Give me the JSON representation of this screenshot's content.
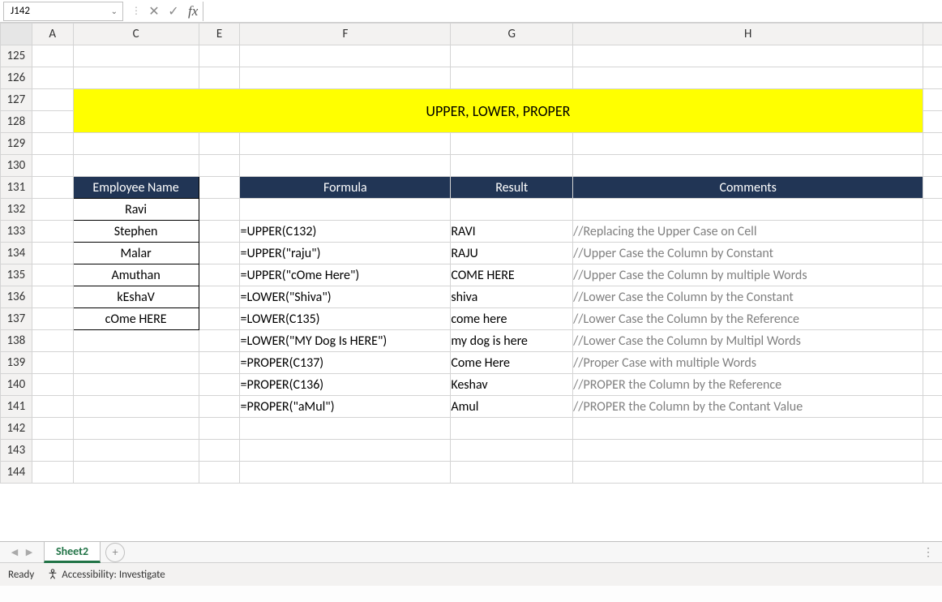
{
  "formula_bar": {
    "cell_ref": "J142",
    "fx": "fx",
    "input": ""
  },
  "columns": {
    "A": "A",
    "C": "C",
    "E": "E",
    "F": "F",
    "G": "G",
    "H": "H"
  },
  "rows": [
    "125",
    "126",
    "127",
    "128",
    "129",
    "130",
    "131",
    "132",
    "133",
    "134",
    "135",
    "136",
    "137",
    "138",
    "139",
    "140",
    "141",
    "142",
    "143",
    "144"
  ],
  "banner": "UPPER, LOWER, PROPER",
  "headers": {
    "employee": "Employee Name",
    "formula": "Formula",
    "result": "Result",
    "comments": "Comments"
  },
  "employees": [
    "Ravi",
    "Stephen",
    "Malar",
    "Amuthan",
    "kEshaV",
    "cOme HERE"
  ],
  "data": [
    {
      "formula": "=UPPER(C132)",
      "result": "RAVI",
      "comment": "//Replacing the Upper Case on Cell"
    },
    {
      "formula": "=UPPER(\"raju\")",
      "result": "RAJU",
      "comment": "//Upper Case the Column by Constant"
    },
    {
      "formula": "=UPPER(\"cOme Here\")",
      "result": "COME HERE",
      "comment": "//Upper Case the Column by multiple Words"
    },
    {
      "formula": "=LOWER(\"Shiva\")",
      "result": "shiva",
      "comment": "//Lower Case the Column by the Constant"
    },
    {
      "formula": "=LOWER(C135)",
      "result": "come here",
      "comment": "//Lower Case the Column by the Reference"
    },
    {
      "formula": "=LOWER(\"MY Dog Is HERE\")",
      "result": "my dog is here",
      "comment": "//Lower Case the Column by Multipl Words"
    },
    {
      "formula": "=PROPER(C137)",
      "result": "Come Here",
      "comment": "//Proper Case with multiple Words"
    },
    {
      "formula": "=PROPER(C136)",
      "result": "Keshav",
      "comment": "//PROPER the Column by the Reference"
    },
    {
      "formula": "=PROPER(\"aMul\")",
      "result": "Amul",
      "comment": "//PROPER the Column by the Contant Value"
    }
  ],
  "sheet_tab": "Sheet2",
  "status": {
    "ready": "Ready",
    "accessibility": "Accessibility: Investigate"
  }
}
